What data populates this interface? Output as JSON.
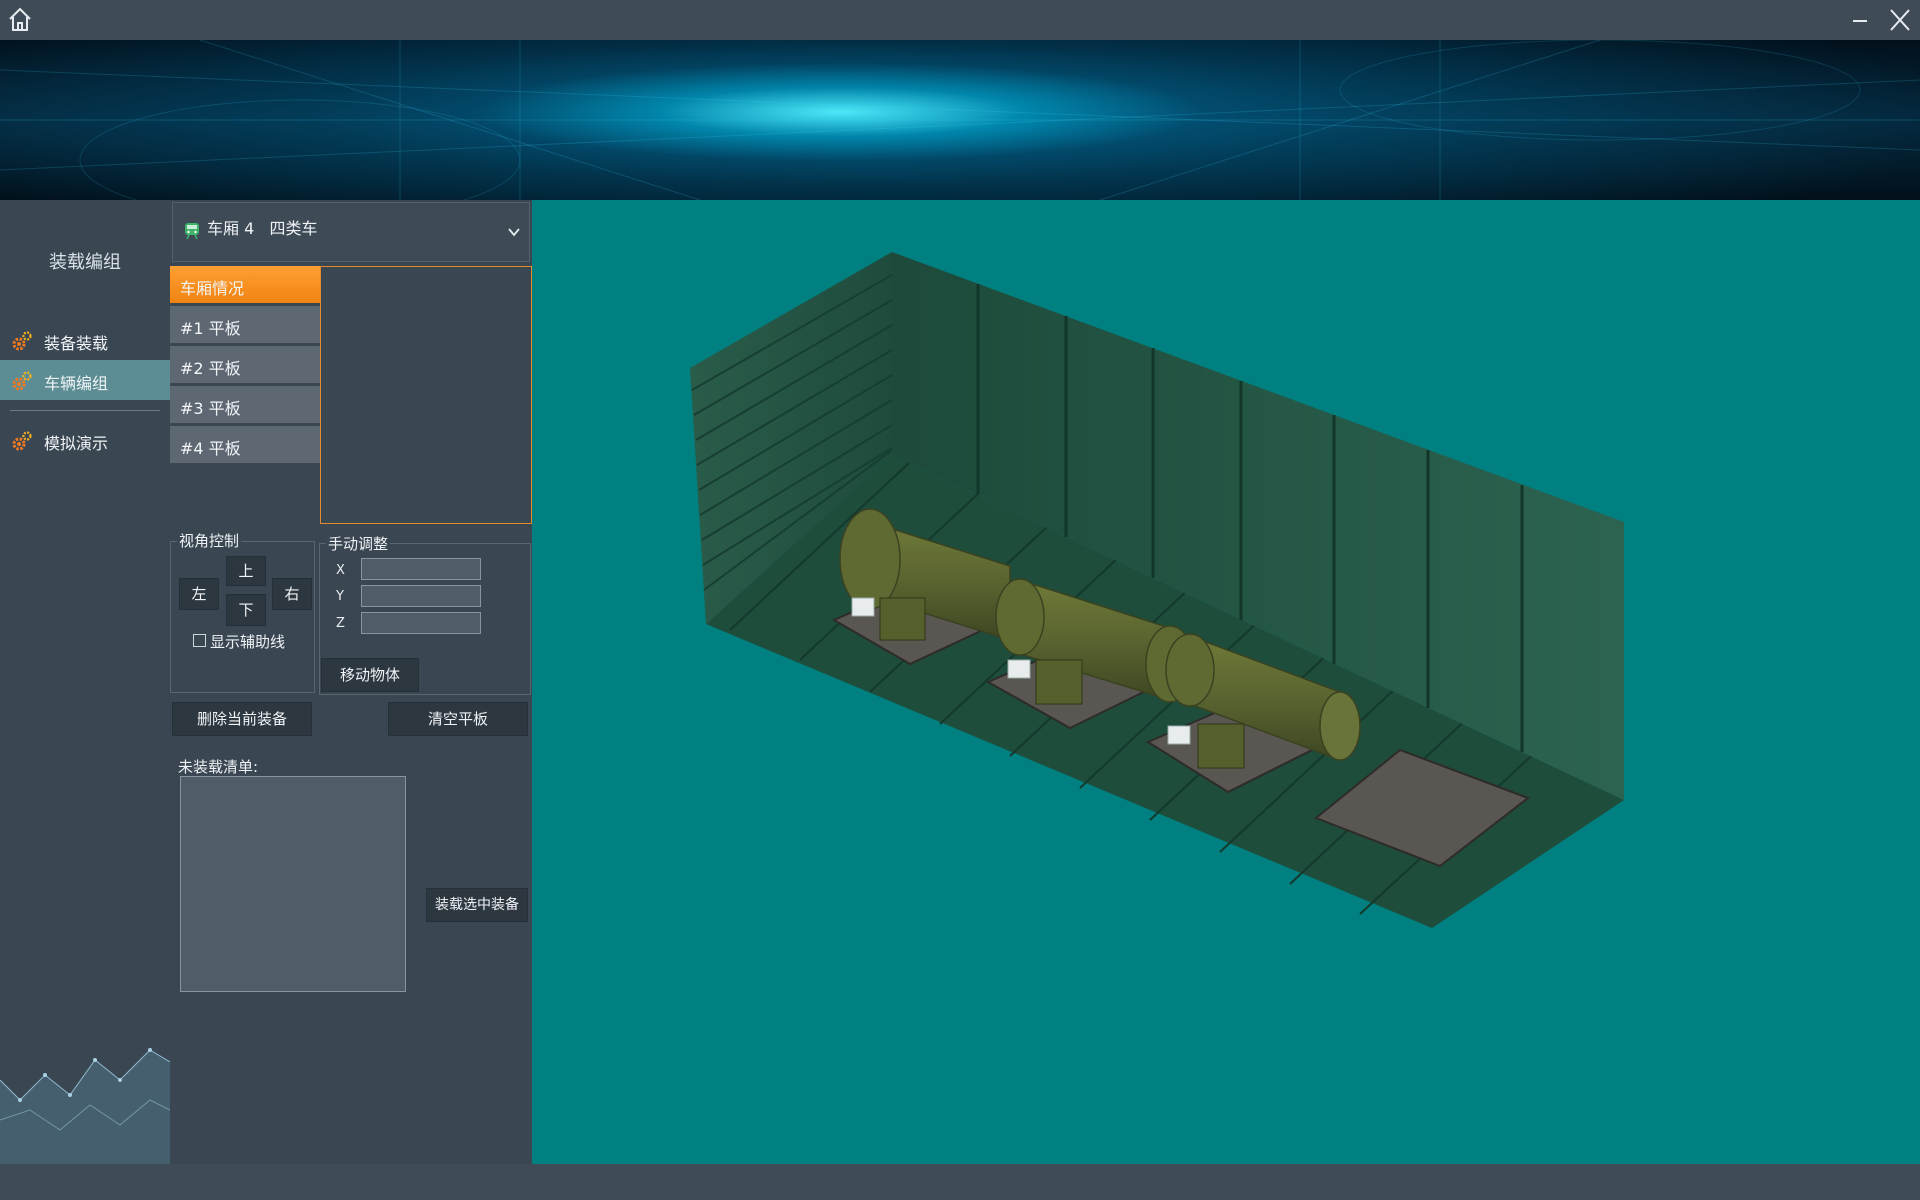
{
  "window": {
    "home_icon": "home-icon",
    "minimize_icon": "minimize-icon",
    "close_icon": "close-icon"
  },
  "sidebar": {
    "title": "装载编组",
    "items": [
      {
        "label": "装备装载",
        "icon": "gear-icon"
      },
      {
        "label": "车辆编组",
        "icon": "gear-icon",
        "active": true
      },
      {
        "label": "模拟演示",
        "icon": "gear-icon"
      }
    ]
  },
  "car_selector": {
    "value": "车厢 4   四类车",
    "icon": "train-icon"
  },
  "tabs": [
    {
      "label": "车厢情况",
      "active": true
    },
    {
      "label": "#1 平板"
    },
    {
      "label": "#2 平板"
    },
    {
      "label": "#3 平板"
    },
    {
      "label": "#4 平板"
    }
  ],
  "view_control": {
    "title": "视角控制",
    "up": "上",
    "down": "下",
    "left": "左",
    "right": "右",
    "show_guides": "显示辅助线",
    "show_guides_checked": false
  },
  "manual_adjust": {
    "title": "手动调整",
    "x_label": "X",
    "y_label": "Y",
    "z_label": "Z",
    "x_value": "",
    "y_value": "",
    "z_value": "",
    "move_button": "移动物体"
  },
  "actions": {
    "delete_current": "删除当前装备",
    "clear_flatbed": "清空平板"
  },
  "unloaded": {
    "title": "未装载清单:",
    "items": [],
    "load_selected": "装载选中装备"
  },
  "colors": {
    "accent_orange": "#f5901e",
    "viewport_bg": "#008080",
    "sidebar_active": "#5c8d94",
    "panel_bg": "#3a4652"
  }
}
